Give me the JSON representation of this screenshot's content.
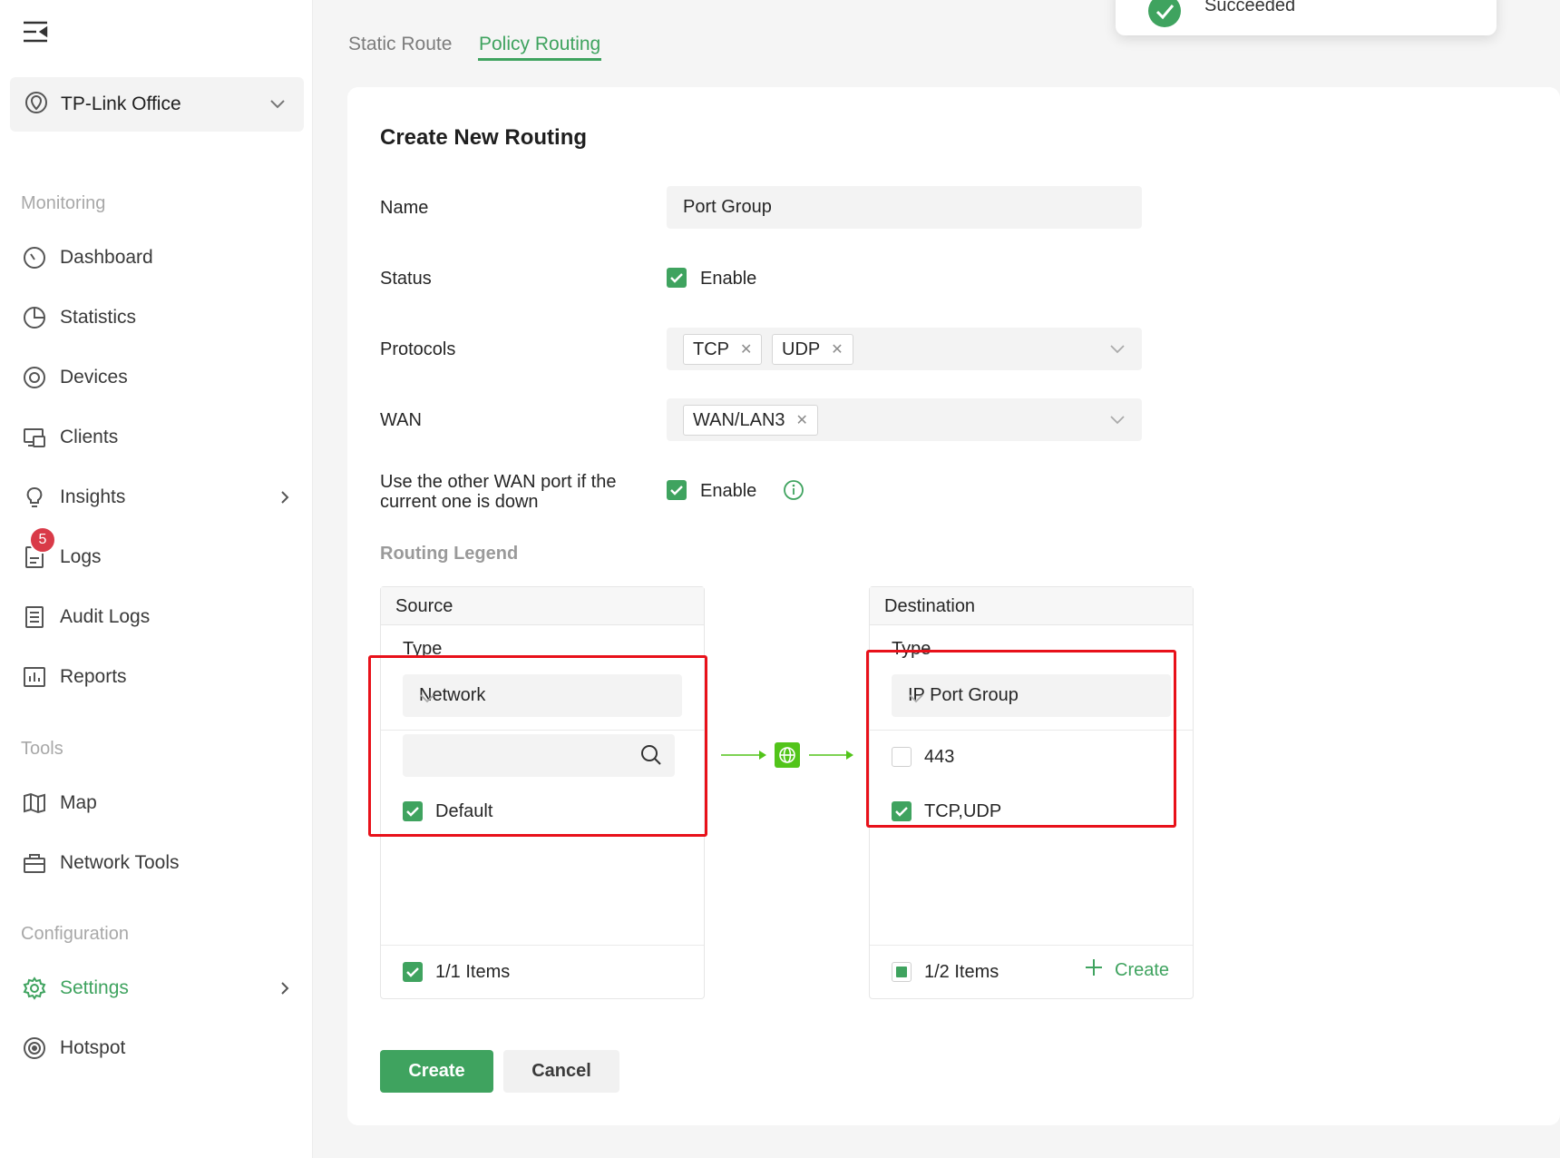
{
  "site": {
    "name": "TP-Link Office"
  },
  "sidebar": {
    "sections": {
      "monitoring": "Monitoring",
      "tools": "Tools",
      "configuration": "Configuration"
    },
    "items": {
      "dashboard": "Dashboard",
      "statistics": "Statistics",
      "devices": "Devices",
      "clients": "Clients",
      "insights": "Insights",
      "logs": "Logs",
      "logs_badge": "5",
      "audit_logs": "Audit Logs",
      "reports": "Reports",
      "map": "Map",
      "network_tools": "Network Tools",
      "settings": "Settings",
      "hotspot": "Hotspot"
    }
  },
  "tabs": {
    "static_route": "Static Route",
    "policy_routing": "Policy Routing"
  },
  "toast": {
    "message": "Succeeded"
  },
  "form": {
    "title": "Create New Routing",
    "name_label": "Name",
    "name_value": "Port Group",
    "status_label": "Status",
    "status_enable": "Enable",
    "protocols_label": "Protocols",
    "protocols": [
      "TCP",
      "UDP"
    ],
    "wan_label": "WAN",
    "wan_values": [
      "WAN/LAN3"
    ],
    "failover_label_line1": "Use the other WAN port if the",
    "failover_label_line2": "current one is down",
    "failover_enable": "Enable",
    "legend_title": "Routing Legend"
  },
  "source": {
    "header": "Source",
    "type_label": "Type",
    "type_value": "Network",
    "items": [
      {
        "label": "Default",
        "checked": true
      }
    ],
    "footer_count": "1/1 Items"
  },
  "destination": {
    "header": "Destination",
    "type_label": "Type",
    "type_value": "IP Port Group",
    "items": [
      {
        "label": "443",
        "checked": false
      },
      {
        "label": "TCP,UDP",
        "checked": true
      }
    ],
    "footer_count": "1/2 Items",
    "create_label": "Create"
  },
  "actions": {
    "create": "Create",
    "cancel": "Cancel"
  },
  "colors": {
    "accent": "#3fa35f",
    "highlight": "#e8111a",
    "badge": "#d93a48"
  }
}
